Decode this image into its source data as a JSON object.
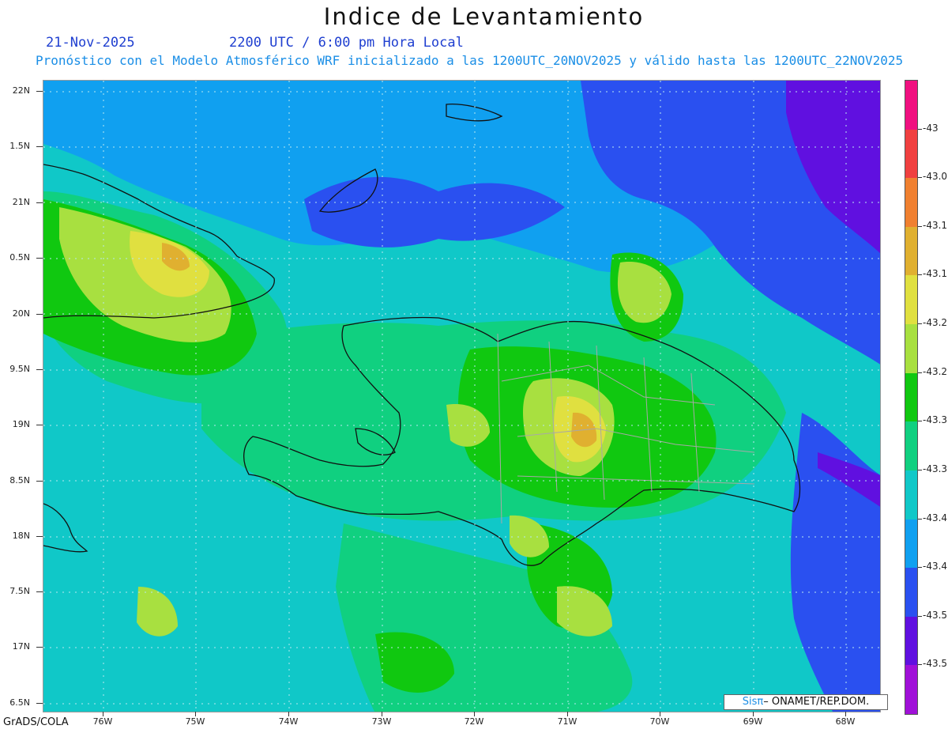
{
  "header": {
    "title": "Indice de Levantamiento",
    "date": "21-Nov-2025",
    "time": "2200 UTC / 6:00 pm Hora Local",
    "subtitle": "Pronóstico con el Modelo Atmosférico WRF inicializado a las 1200UTC_20NOV2025 y válido hasta las  1200UTC_22NOV2025"
  },
  "map": {
    "lat_labels": [
      "22N",
      "1.5N",
      "21N",
      "0.5N",
      "20N",
      "9.5N",
      "19N",
      "8.5N",
      "18N",
      "7.5N",
      "17N",
      "6.5N"
    ],
    "lon_labels": [
      "76W",
      "75W",
      "74W",
      "73W",
      "72W",
      "71W",
      "70W",
      "69W",
      "68W"
    ],
    "colors": {
      "background_field": "#0fc8c6",
      "coastline": "#111111",
      "provinces": "#a8a8a8"
    }
  },
  "colorbar": {
    "colors": [
      "#f01080",
      "#f04040",
      "#f08030",
      "#e0b030",
      "#e0e040",
      "#a8e040",
      "#10c810",
      "#10d080",
      "#10c8c8",
      "#10a0f0",
      "#2a50f0",
      "#6010e0",
      "#a010d8"
    ],
    "labels": [
      "-43",
      "-43.0",
      "-43.1",
      "-43.1",
      "-43.2",
      "-43.2",
      "-43.3",
      "-43.3",
      "-43.4",
      "-43.4",
      "-43.5",
      "-43.5"
    ]
  },
  "footer": {
    "grads": "GrADS/COLA",
    "credit_prefix": "Sis",
    "credit_symbol": "π",
    "credit_suffix": "– ONAMET/REP.DOM."
  }
}
